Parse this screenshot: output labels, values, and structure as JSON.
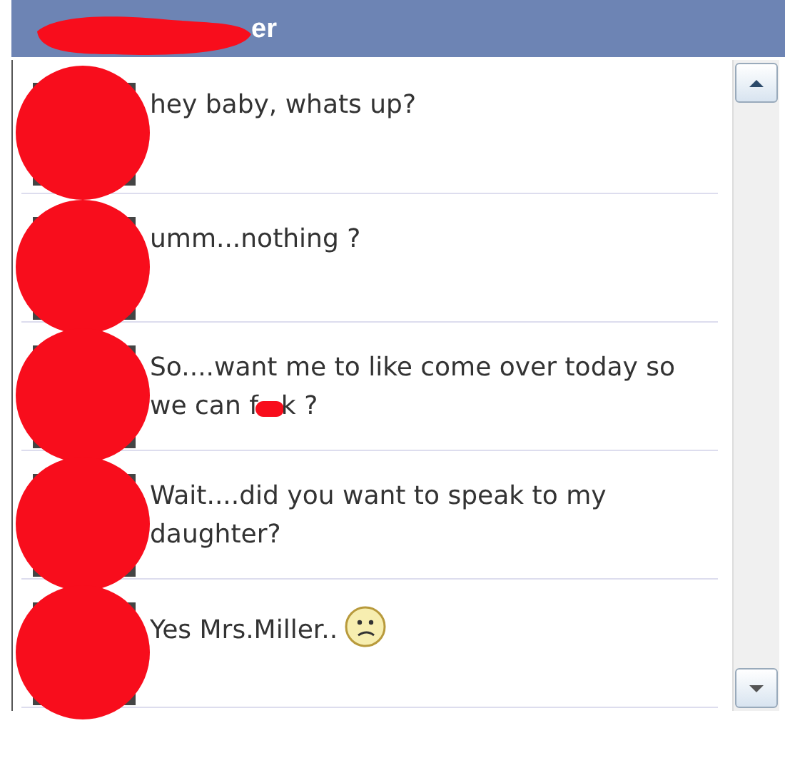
{
  "window": {
    "title": "er"
  },
  "messages": [
    {
      "parts": [
        {
          "kind": "text",
          "text": "hey baby, whats up?"
        }
      ]
    },
    {
      "parts": [
        {
          "kind": "text",
          "text": "umm...nothing ?"
        }
      ]
    },
    {
      "parts": [
        {
          "kind": "text",
          "text": "So....want me to like come over today so we can f"
        },
        {
          "kind": "redaction"
        },
        {
          "kind": "text",
          "text": "k  ?"
        }
      ]
    },
    {
      "parts": [
        {
          "kind": "text",
          "text": "Wait....did you want to speak to my daughter?"
        }
      ]
    },
    {
      "parts": [
        {
          "kind": "text",
          "text": "Yes  Mrs.Miller.."
        },
        {
          "kind": "emoticon"
        }
      ]
    }
  ]
}
